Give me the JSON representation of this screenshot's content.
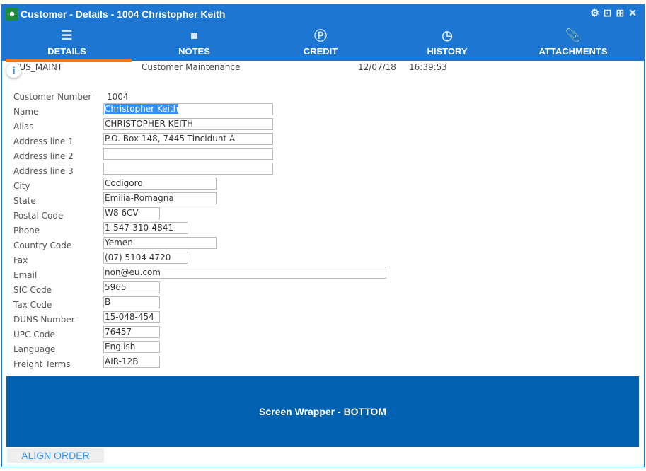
{
  "window": {
    "title": "Customer - Details - 1004 Christopher Keith"
  },
  "tabs": [
    {
      "label": "DETAILS",
      "icon": "details-icon"
    },
    {
      "label": "NOTES",
      "icon": "note-icon"
    },
    {
      "label": "CREDIT",
      "icon": "dollar-icon"
    },
    {
      "label": "HISTORY",
      "icon": "clock-icon"
    },
    {
      "label": "ATTACHMENTS",
      "icon": "paperclip-icon"
    }
  ],
  "info": {
    "program": "CUS_MAINT",
    "description": "Customer Maintenance",
    "date": "12/07/18",
    "time": "16:39:53"
  },
  "customer_number": {
    "label": "Customer Number",
    "value": "1004"
  },
  "fields": [
    {
      "label": "Name",
      "value": "Christopher Keith"
    },
    {
      "label": "Alias",
      "value": "CHRISTOPHER KEITH"
    },
    {
      "label": "Address line 1",
      "value": "P.O. Box 148, 7445 Tincidunt A"
    },
    {
      "label": "Address line 2",
      "value": ""
    },
    {
      "label": "Address line 3",
      "value": ""
    },
    {
      "label": "City",
      "value": "Codigoro"
    },
    {
      "label": "State",
      "value": "Emilia-Romagna"
    },
    {
      "label": "Postal Code",
      "value": "W8 6CV"
    },
    {
      "label": "Phone",
      "value": "1-547-310-4841"
    },
    {
      "label": "Country Code",
      "value": "Yemen"
    },
    {
      "label": "Fax",
      "value": "(07) 5104 4720"
    },
    {
      "label": "Email",
      "value": "non@eu.com"
    },
    {
      "label": "SIC Code",
      "value": "5965"
    },
    {
      "label": "Tax Code",
      "value": "B"
    },
    {
      "label": "DUNS Number",
      "value": "15-048-454"
    },
    {
      "label": "UPC Code",
      "value": "76457"
    },
    {
      "label": "Language",
      "value": "English"
    },
    {
      "label": "Freight Terms",
      "value": "AIR-12B"
    }
  ],
  "bottom": {
    "label": "Screen Wrapper - BOTTOM"
  },
  "align_button": "ALIGN ORDER"
}
